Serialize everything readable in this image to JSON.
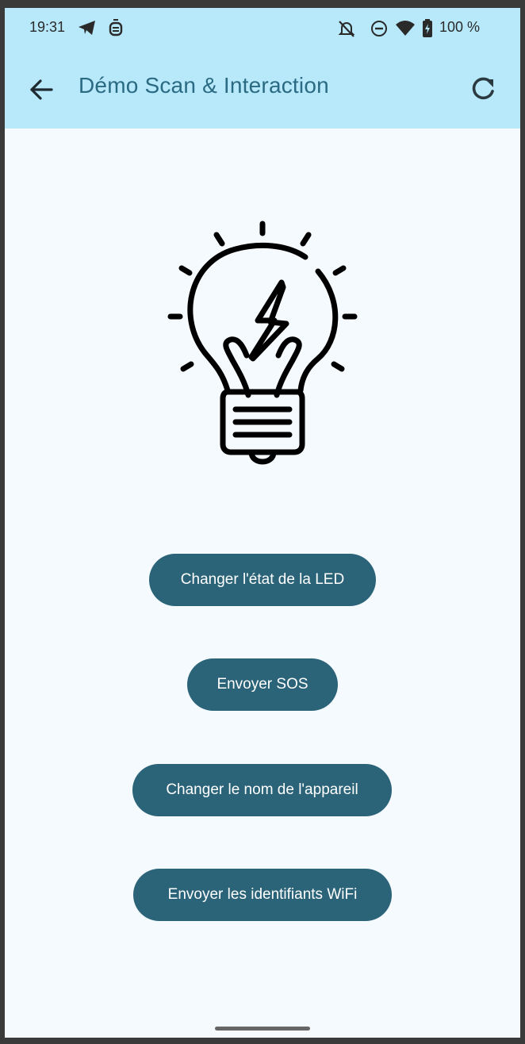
{
  "status_bar": {
    "time": "19:31",
    "battery_text": "100 %",
    "icons": [
      "telegram-icon",
      "notification-app-icon",
      "notifications-off-icon",
      "do-not-disturb-icon",
      "wifi-icon",
      "battery-charging-icon"
    ]
  },
  "app_bar": {
    "title": "Démo Scan & Interaction",
    "back_icon": "arrow-back-icon",
    "refresh_icon": "refresh-icon",
    "background": "#b7e9fb",
    "title_color": "#2a6a82"
  },
  "illustration": {
    "icon": "lightbulb-bolt-icon"
  },
  "actions": {
    "led_label": "Changer l'état de la LED",
    "sos_label": "Envoyer SOS",
    "rename_label": "Changer le nom de l'appareil",
    "wifi_label": "Envoyer les identifiants WiFi",
    "button_color": "#2b6378"
  }
}
